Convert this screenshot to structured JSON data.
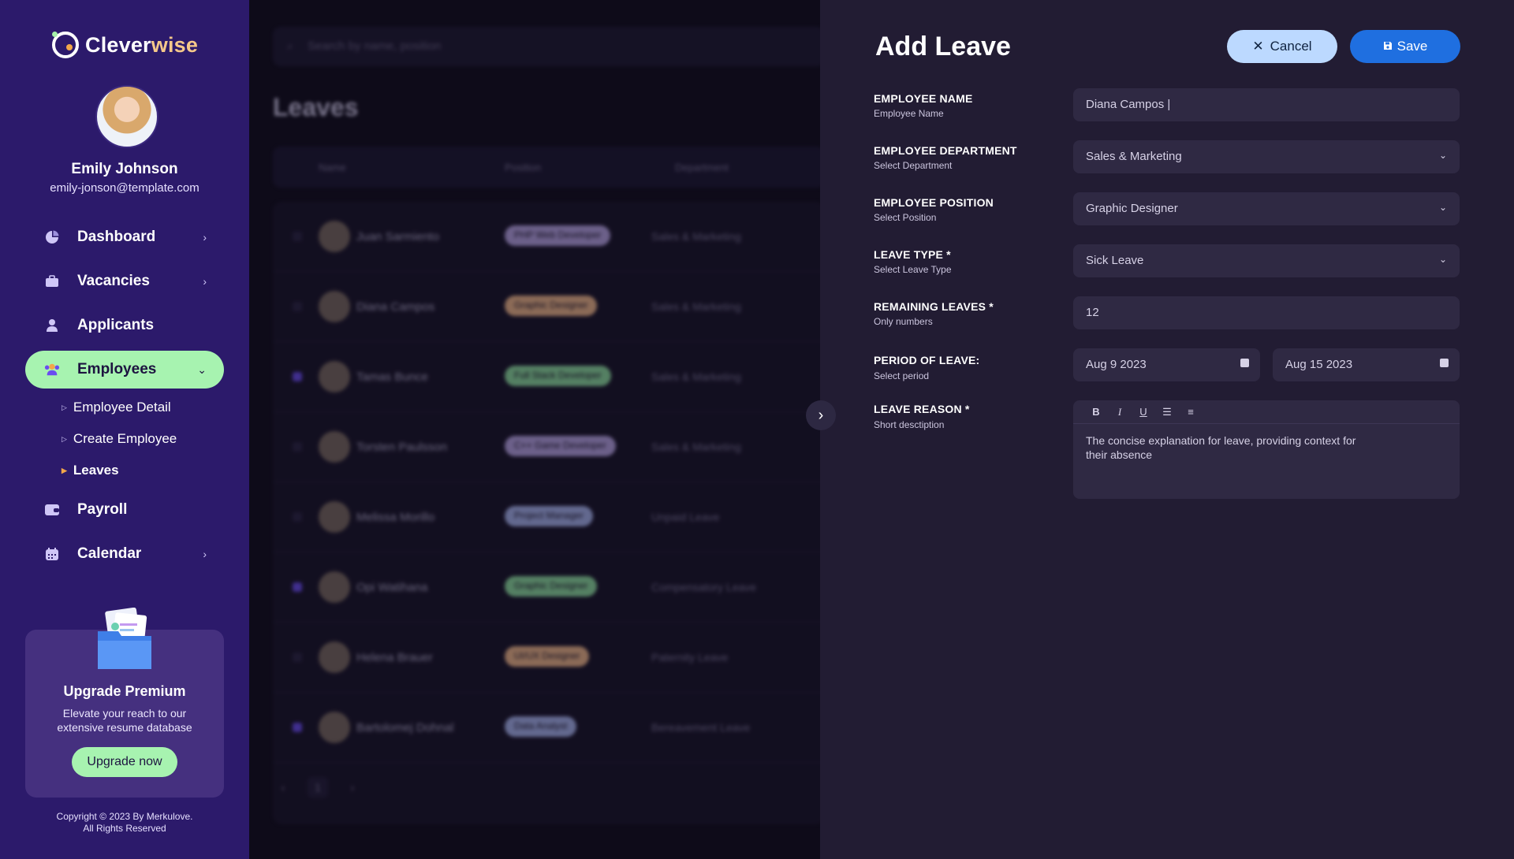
{
  "app": {
    "logo_part1": "Clever",
    "logo_part2": "wise"
  },
  "user": {
    "name": "Emily Johnson",
    "email": "emily-jonson@template.com"
  },
  "nav": {
    "dashboard": "Dashboard",
    "vacancies": "Vacancies",
    "applicants": "Applicants",
    "employees": "Employees",
    "employee_detail": "Employee Detail",
    "create_employee": "Create Employee",
    "leaves": "Leaves",
    "payroll": "Payroll",
    "calendar": "Calendar"
  },
  "premium": {
    "title": "Upgrade Premium",
    "text": "Elevate your reach to our extensive resume database",
    "button": "Upgrade now"
  },
  "copyright": {
    "line1": "Copyright © 2023 By Merkulove.",
    "line2": "All Rights Reserved"
  },
  "background": {
    "search_placeholder": "Search by name, position",
    "title": "Leaves",
    "col_name": "Name",
    "col_position": "Position",
    "col_department": "Department",
    "rows": [
      {
        "name": "Juan Sarmiento",
        "position": "PHP Web Developer",
        "dept": "Sales & Marketing",
        "color": "#b9a6e6",
        "checked": false
      },
      {
        "name": "Diana Campos",
        "position": "Graphic Designer",
        "dept": "Sales & Marketing",
        "color": "#f2b98a",
        "checked": false
      },
      {
        "name": "Tamas Bunce",
        "position": "Full Stack Developer",
        "dept": "Sales & Marketing",
        "color": "#8fe0a0",
        "checked": true
      },
      {
        "name": "Torsten Paulsson",
        "position": "C++ Game Developer",
        "dept": "Sales & Marketing",
        "color": "#b9a6e6",
        "checked": false
      },
      {
        "name": "Melissa Morillo",
        "position": "Project Manager",
        "dept": "Unpaid Leave",
        "color": "#a9b6f0",
        "checked": false
      },
      {
        "name": "Opi Watihana",
        "position": "Graphic Designer",
        "dept": "Compensatory Leave",
        "color": "#8fe0a0",
        "checked": true
      },
      {
        "name": "Helena Brauer",
        "position": "UI/UX Designer",
        "dept": "Paternity Leave",
        "color": "#f2b98a",
        "checked": false
      },
      {
        "name": "Bartolomej Dohnal",
        "position": "Data Analyst",
        "dept": "Bereavement Leave",
        "color": "#a9b6f0",
        "checked": true
      }
    ],
    "page": "1"
  },
  "form": {
    "title": "Add Leave",
    "cancel_label": "Cancel",
    "save_label": "Save",
    "employee_name": {
      "label": "EMPLOYEE NAME",
      "hint": "Employee Name",
      "value": "Diana Campos |"
    },
    "department": {
      "label": "EMPLOYEE DEPARTMENT",
      "hint": "Select Department",
      "value": "Sales & Marketing"
    },
    "position": {
      "label": "EMPLOYEE POSITION",
      "hint": "Select Position",
      "value": "Graphic Designer"
    },
    "leave_type": {
      "label": "LEAVE TYPE *",
      "hint": "Select Leave Type",
      "value": "Sick Leave"
    },
    "remaining": {
      "label": "REMAINING LEAVES *",
      "hint": "Only numbers",
      "value": "12"
    },
    "period": {
      "label": "PERIOD OF LEAVE:",
      "hint": "Select period",
      "start": "Aug 9 2023",
      "end": "Aug 15 2023"
    },
    "reason": {
      "label": "LEAVE REASON *",
      "hint": "Short desctiption",
      "value": "The concise explanation for leave, providing context for their absence"
    }
  }
}
